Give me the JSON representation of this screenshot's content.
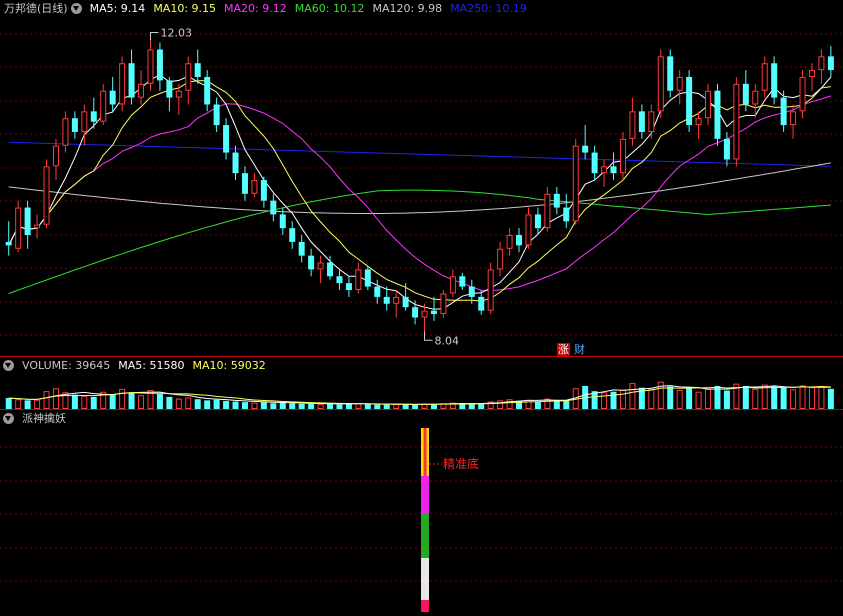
{
  "title": "万邦德(日线)",
  "colors": {
    "up": "#ff3b3b",
    "down": "#54ffff",
    "ma5": "#ffffff",
    "ma10": "#ffff60",
    "ma20": "#ff33ff",
    "ma60": "#33dd33",
    "ma120": "#c8c8c8",
    "ma250": "#2222ee",
    "grid": "#7a0000"
  },
  "price_legend": [
    {
      "label": "MA5: 9.14",
      "color": "#ffffff"
    },
    {
      "label": "MA10: 9.15",
      "color": "#ffff60"
    },
    {
      "label": "MA20: 9.12",
      "color": "#ff33ff"
    },
    {
      "label": "MA60: 10.12",
      "color": "#33dd33"
    },
    {
      "label": "MA120: 9.98",
      "color": "#c8c8c8"
    },
    {
      "label": "MA250: 10.19",
      "color": "#2222ee"
    }
  ],
  "annotations": {
    "high": "12.03",
    "low": "8.04"
  },
  "badges": {
    "zhang": "涨",
    "cai": "财"
  },
  "volume_legend": [
    {
      "label": "VOLUME: 39645",
      "color": "#c8c8c8"
    },
    {
      "label": "MA5: 51580",
      "color": "#ffffff"
    },
    {
      "label": "MA10: 59032",
      "color": "#ffff60"
    }
  ],
  "indicator": {
    "name": "派神擒妖",
    "signal_label": "精准底",
    "colors": [
      "#ffdd00",
      "#ff3333",
      "#ee22ee",
      "#22aa22",
      "#e8e8e8",
      "#ff1166"
    ]
  },
  "chart_data": {
    "type": "candlestick",
    "series_order": [
      "open",
      "high",
      "low",
      "close"
    ],
    "price_range": [
      7.6,
      12.3
    ],
    "candles": [
      [
        9.1,
        9.4,
        8.9,
        9.05
      ],
      [
        9.0,
        9.7,
        8.95,
        9.6
      ],
      [
        9.6,
        9.7,
        9.0,
        9.2
      ],
      [
        9.3,
        9.5,
        9.15,
        9.35
      ],
      [
        9.35,
        10.3,
        9.3,
        10.2
      ],
      [
        10.2,
        10.6,
        10.0,
        10.5
      ],
      [
        10.5,
        11.0,
        10.4,
        10.9
      ],
      [
        10.9,
        11.0,
        10.6,
        10.7
      ],
      [
        10.7,
        11.1,
        10.5,
        11.0
      ],
      [
        11.0,
        11.2,
        10.75,
        10.85
      ],
      [
        10.85,
        11.4,
        10.8,
        11.3
      ],
      [
        11.3,
        11.5,
        11.0,
        11.1
      ],
      [
        11.1,
        11.8,
        11.0,
        11.7
      ],
      [
        11.7,
        11.9,
        11.1,
        11.2
      ],
      [
        11.2,
        11.6,
        11.1,
        11.4
      ],
      [
        11.4,
        12.03,
        11.3,
        11.9
      ],
      [
        11.9,
        12.0,
        11.3,
        11.45
      ],
      [
        11.45,
        11.5,
        11.0,
        11.2
      ],
      [
        11.2,
        11.4,
        10.95,
        11.3
      ],
      [
        11.3,
        11.8,
        11.1,
        11.7
      ],
      [
        11.7,
        11.9,
        11.4,
        11.5
      ],
      [
        11.5,
        11.6,
        11.0,
        11.1
      ],
      [
        11.1,
        11.2,
        10.7,
        10.8
      ],
      [
        10.8,
        10.9,
        10.3,
        10.4
      ],
      [
        10.4,
        10.5,
        10.0,
        10.1
      ],
      [
        10.1,
        10.2,
        9.7,
        9.8
      ],
      [
        9.8,
        10.1,
        9.75,
        10.0
      ],
      [
        10.0,
        10.05,
        9.6,
        9.7
      ],
      [
        9.7,
        9.8,
        9.4,
        9.5
      ],
      [
        9.5,
        9.6,
        9.2,
        9.3
      ],
      [
        9.3,
        9.4,
        9.0,
        9.1
      ],
      [
        9.1,
        9.2,
        8.8,
        8.9
      ],
      [
        8.9,
        9.0,
        8.6,
        8.7
      ],
      [
        8.7,
        8.9,
        8.5,
        8.8
      ],
      [
        8.8,
        8.9,
        8.55,
        8.6
      ],
      [
        8.6,
        8.7,
        8.4,
        8.5
      ],
      [
        8.5,
        8.6,
        8.3,
        8.4
      ],
      [
        8.4,
        8.8,
        8.35,
        8.7
      ],
      [
        8.7,
        8.75,
        8.4,
        8.45
      ],
      [
        8.45,
        8.55,
        8.2,
        8.3
      ],
      [
        8.3,
        8.45,
        8.1,
        8.2
      ],
      [
        8.2,
        8.4,
        8.0,
        8.3
      ],
      [
        8.3,
        8.5,
        8.1,
        8.15
      ],
      [
        8.15,
        8.25,
        7.9,
        8.0
      ],
      [
        8.0,
        8.2,
        7.8,
        8.1
      ],
      [
        8.1,
        8.3,
        7.95,
        8.05
      ],
      [
        8.05,
        8.4,
        8.0,
        8.35
      ],
      [
        8.35,
        8.7,
        8.3,
        8.6
      ],
      [
        8.6,
        8.65,
        8.4,
        8.45
      ],
      [
        8.45,
        8.55,
        8.2,
        8.3
      ],
      [
        8.3,
        8.4,
        8.04,
        8.1
      ],
      [
        8.1,
        8.8,
        8.05,
        8.7
      ],
      [
        8.7,
        9.1,
        8.6,
        9.0
      ],
      [
        9.0,
        9.3,
        8.9,
        9.2
      ],
      [
        9.2,
        9.3,
        8.95,
        9.05
      ],
      [
        9.05,
        9.6,
        9.0,
        9.5
      ],
      [
        9.5,
        9.6,
        9.2,
        9.3
      ],
      [
        9.3,
        9.9,
        9.25,
        9.8
      ],
      [
        9.8,
        9.9,
        9.5,
        9.6
      ],
      [
        9.6,
        9.8,
        9.3,
        9.4
      ],
      [
        9.4,
        10.6,
        9.35,
        10.5
      ],
      [
        10.5,
        10.8,
        10.3,
        10.4
      ],
      [
        10.4,
        10.5,
        10.0,
        10.1
      ],
      [
        10.1,
        10.3,
        9.9,
        10.2
      ],
      [
        10.2,
        10.4,
        10.0,
        10.1
      ],
      [
        10.1,
        10.7,
        10.0,
        10.6
      ],
      [
        10.6,
        11.2,
        10.5,
        11.0
      ],
      [
        11.0,
        11.1,
        10.6,
        10.7
      ],
      [
        10.7,
        11.1,
        10.6,
        11.0
      ],
      [
        11.0,
        11.9,
        10.9,
        11.8
      ],
      [
        11.8,
        11.9,
        11.2,
        11.3
      ],
      [
        11.3,
        11.6,
        11.1,
        11.5
      ],
      [
        11.5,
        11.6,
        10.7,
        10.8
      ],
      [
        10.8,
        11.0,
        10.6,
        10.9
      ],
      [
        10.9,
        11.4,
        10.8,
        11.3
      ],
      [
        11.3,
        11.4,
        10.5,
        10.6
      ],
      [
        10.6,
        10.7,
        10.2,
        10.3
      ],
      [
        10.3,
        11.5,
        10.2,
        11.4
      ],
      [
        11.4,
        11.6,
        11.0,
        11.1
      ],
      [
        11.1,
        11.4,
        10.9,
        11.3
      ],
      [
        11.3,
        11.8,
        11.2,
        11.7
      ],
      [
        11.7,
        11.8,
        11.1,
        11.2
      ],
      [
        11.2,
        11.3,
        10.7,
        10.8
      ],
      [
        10.8,
        11.1,
        10.6,
        11.0
      ],
      [
        11.0,
        11.6,
        10.9,
        11.5
      ],
      [
        11.5,
        11.7,
        11.3,
        11.6
      ],
      [
        11.6,
        11.9,
        11.4,
        11.8
      ],
      [
        11.8,
        11.95,
        11.5,
        11.6
      ]
    ],
    "volume": [
      38000,
      34000,
      30000,
      32000,
      62000,
      72000,
      58000,
      50000,
      46000,
      42000,
      60000,
      52000,
      70000,
      58000,
      48000,
      66000,
      52000,
      42000,
      36000,
      40000,
      34000,
      30000,
      32000,
      28000,
      26000,
      24000,
      22000,
      24000,
      20000,
      22000,
      20000,
      18000,
      18000,
      17000,
      19000,
      16000,
      18000,
      20000,
      16000,
      15000,
      15000,
      17000,
      16000,
      15000,
      18000,
      17000,
      20000,
      22000,
      18000,
      17000,
      19000,
      26000,
      30000,
      34000,
      28000,
      32000,
      26000,
      36000,
      30000,
      28000,
      72000,
      80000,
      62000,
      58000,
      60000,
      66000,
      90000,
      74000,
      70000,
      95000,
      78000,
      66000,
      72000,
      60000,
      70000,
      80000,
      64000,
      88000,
      80000,
      70000,
      85000,
      78000,
      74000,
      68000,
      82000,
      76000,
      80000,
      70000
    ],
    "volume_range": [
      0,
      125000
    ]
  }
}
